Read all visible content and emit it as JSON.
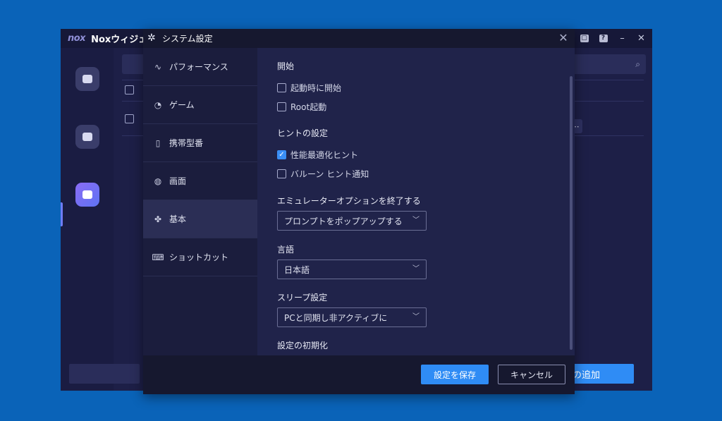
{
  "background_app": {
    "logo": "nox",
    "title": "Noxウィジェ",
    "window_controls": [
      "?",
      "–",
      "✕"
    ],
    "bottom_button_label": "の追加"
  },
  "dialog": {
    "title": "システム設定",
    "close_glyph": "✕",
    "nav": [
      {
        "label": "パフォーマンス",
        "icon": "waveform-icon"
      },
      {
        "label": "ゲーム",
        "icon": "gamepad-icon"
      },
      {
        "label": "携帯型番",
        "icon": "phone-icon"
      },
      {
        "label": "画面",
        "icon": "palette-icon"
      },
      {
        "label": "基本",
        "icon": "puzzle-icon",
        "active": true
      },
      {
        "label": "ショットカット",
        "icon": "keyboard-icon"
      }
    ],
    "sections": {
      "startup_title": "開始",
      "startup_options": [
        {
          "label": "起動時に開始",
          "checked": false
        },
        {
          "label": "Root起動",
          "checked": false
        }
      ],
      "hints_title": "ヒントの設定",
      "hint_options": [
        {
          "label": "性能最適化ヒント",
          "checked": true
        },
        {
          "label": "バルーン ヒント通知",
          "checked": false
        }
      ],
      "exit_title": "エミュレーターオプションを終了する",
      "exit_value": "プロンプトをポップアップする",
      "language_title": "言語",
      "language_value": "日本語",
      "sleep_title": "スリープ設定",
      "sleep_value": "PCと同期し非アクティブに",
      "reset_title": "設定の初期化"
    },
    "footer": {
      "save_label": "設定を保存",
      "cancel_label": "キャンセル"
    }
  }
}
